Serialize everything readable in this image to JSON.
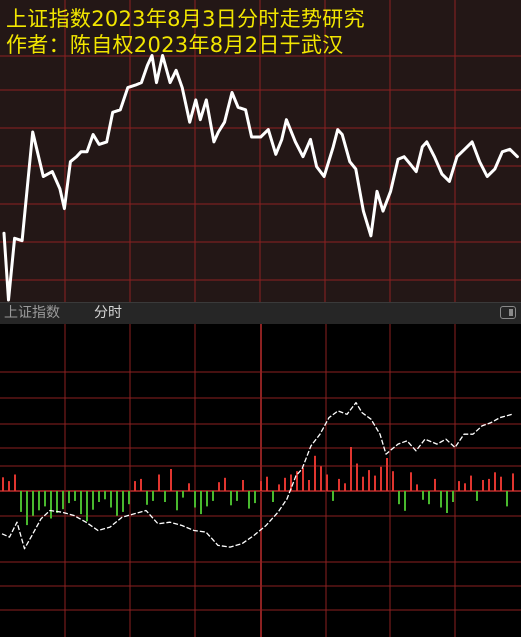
{
  "header": {
    "title_line1": "上证指数2023年8月3日分时走势研究",
    "title_line2": "作者：陈自权2023年8月2日于武汉"
  },
  "label_bar": {
    "index_name": "上证指数",
    "tab_label": "分时",
    "restore_icon": "window-restore-icon"
  },
  "colors": {
    "upper_bg": "#231716",
    "grid": "#8c2121",
    "title": "#f2e600",
    "line": "#ffffff",
    "bar_up": "#e0352f",
    "bar_down": "#49b92e"
  },
  "chart_data": [
    {
      "type": "line",
      "panel": "upper",
      "x_unit": "minutes from 09:30",
      "y_unit": "relative level, 0 = session low, 100 = session high",
      "grid": true,
      "x": [
        0,
        3,
        7,
        12,
        19,
        26,
        32,
        37,
        40,
        44,
        48,
        51,
        55,
        59,
        63,
        68,
        72,
        77,
        82,
        87,
        91,
        95,
        98,
        101,
        105,
        110,
        114,
        118,
        123,
        127,
        130,
        134,
        139,
        142,
        146,
        151,
        155,
        160,
        164,
        170,
        175,
        180,
        184,
        187,
        193,
        198,
        203,
        207,
        212,
        218,
        221,
        224,
        229,
        233,
        238,
        243,
        247,
        251,
        256,
        261,
        265,
        269,
        273,
        277,
        280,
        285,
        290,
        295,
        300,
        305,
        310,
        315,
        320,
        325,
        330,
        335,
        340
      ],
      "y": [
        27,
        0,
        25,
        24,
        68,
        50,
        52,
        45,
        37,
        56,
        58,
        60,
        60,
        67,
        63,
        64,
        76,
        77,
        86,
        87,
        88,
        95,
        99,
        88,
        99,
        88,
        93,
        86,
        72,
        81,
        73,
        81,
        64,
        68,
        72,
        84,
        78,
        77,
        66,
        66,
        69,
        59,
        65,
        73,
        64,
        58,
        65,
        54,
        50,
        62,
        69,
        67,
        56,
        53,
        36,
        26,
        44,
        36,
        44,
        57,
        58,
        55,
        52,
        62,
        64,
        58,
        51,
        48,
        58,
        61,
        64,
        56,
        50,
        53,
        60,
        61,
        58
      ],
      "ylim": [
        0,
        100
      ]
    },
    {
      "type": "line",
      "panel": "lower",
      "x_unit": "minutes from 09:30",
      "y_unit": "relative level, 0 = session low, 100 = session high",
      "grid": true,
      "x": [
        0,
        5,
        10,
        15,
        20,
        26,
        32,
        40,
        48,
        56,
        64,
        72,
        80,
        88,
        96,
        104,
        112,
        120,
        128,
        136,
        144,
        152,
        160,
        168,
        176,
        184,
        190,
        196,
        200,
        206,
        212,
        218,
        224,
        230,
        236,
        240,
        246,
        252,
        256,
        264,
        270,
        276,
        282,
        290,
        296,
        302,
        308,
        314,
        320,
        326,
        332,
        340
      ],
      "y": [
        17,
        15,
        24,
        8,
        16,
        26,
        31,
        30,
        28,
        24,
        19,
        21,
        27,
        29,
        31,
        23,
        24,
        22,
        19,
        18,
        10,
        9,
        11,
        16,
        22,
        30,
        38,
        52,
        56,
        70,
        77,
        87,
        91,
        89,
        96,
        90,
        86,
        77,
        65,
        71,
        73,
        67,
        74,
        71,
        74,
        69,
        77,
        77,
        82,
        84,
        87,
        89
      ],
      "ylim": [
        0,
        100
      ]
    },
    {
      "type": "bar",
      "panel": "lower",
      "x_unit": "minutes from 09:30",
      "y_unit": "relative value, positive red, negative green",
      "x": [
        0,
        4,
        8,
        12,
        16,
        20,
        24,
        28,
        32,
        36,
        40,
        44,
        48,
        52,
        56,
        60,
        64,
        68,
        72,
        76,
        80,
        84,
        88,
        92,
        96,
        100,
        104,
        108,
        112,
        116,
        120,
        124,
        128,
        132,
        136,
        140,
        144,
        148,
        152,
        156,
        160,
        164,
        168,
        172,
        176,
        180,
        184,
        188,
        192,
        196,
        200,
        204,
        208,
        212,
        216,
        220,
        224,
        228,
        232,
        236,
        240,
        244,
        248,
        252,
        256,
        260,
        264,
        268,
        272,
        276,
        280,
        284,
        288,
        292,
        296,
        300,
        304,
        308,
        312,
        316,
        320,
        324,
        328,
        332,
        336,
        340
      ],
      "values": [
        25,
        18,
        30,
        -38,
        -62,
        -45,
        -35,
        -28,
        -50,
        -40,
        -33,
        -22,
        -18,
        -42,
        -55,
        -34,
        -20,
        -15,
        -30,
        -45,
        -38,
        -24,
        18,
        22,
        -25,
        -18,
        30,
        -20,
        40,
        -35,
        -12,
        14,
        -30,
        -42,
        -28,
        -18,
        16,
        24,
        -26,
        -18,
        20,
        -32,
        -22,
        18,
        26,
        -20,
        12,
        24,
        30,
        36,
        42,
        20,
        64,
        45,
        30,
        -18,
        22,
        14,
        80,
        50,
        26,
        38,
        28,
        44,
        60,
        36,
        -24,
        -36,
        34,
        12,
        -16,
        -24,
        22,
        -30,
        -40,
        -20,
        18,
        14,
        28,
        -18,
        20,
        22,
        34,
        26,
        -28,
        32
      ],
      "ylim": [
        -100,
        100
      ]
    }
  ]
}
